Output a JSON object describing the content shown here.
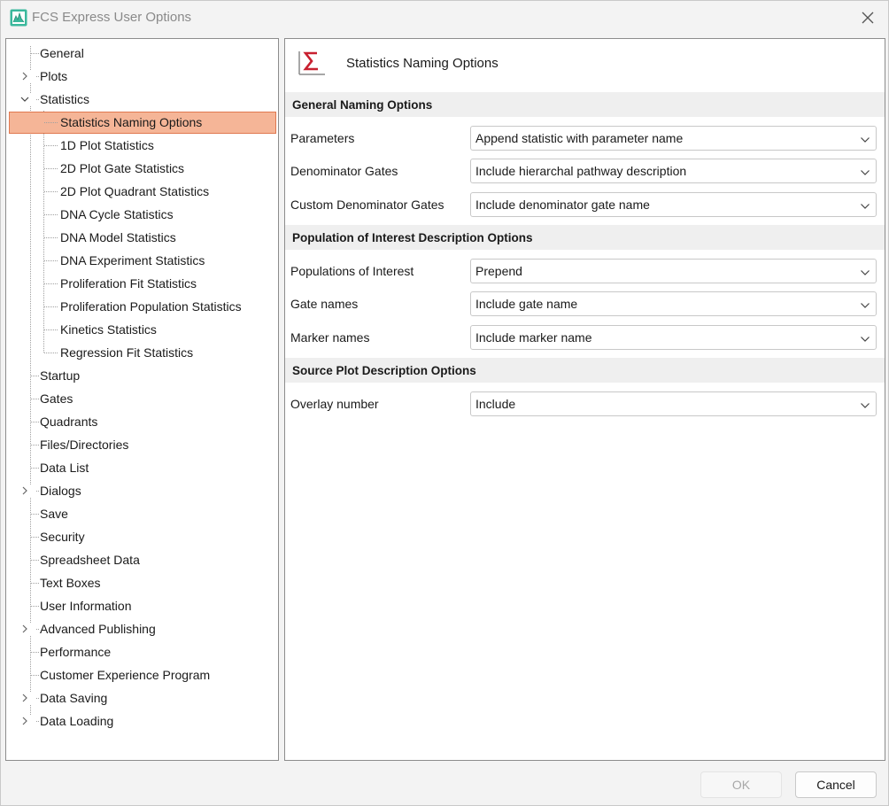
{
  "window": {
    "title": "FCS Express User Options"
  },
  "tree": {
    "items": [
      {
        "label": "General",
        "level": 0,
        "expandable": false
      },
      {
        "label": "Plots",
        "level": 0,
        "expandable": true,
        "expanded": false
      },
      {
        "label": "Statistics",
        "level": 0,
        "expandable": true,
        "expanded": true
      },
      {
        "label": "Statistics Naming Options",
        "level": 1,
        "selected": true
      },
      {
        "label": "1D Plot Statistics",
        "level": 1
      },
      {
        "label": "2D Plot Gate Statistics",
        "level": 1
      },
      {
        "label": "2D Plot Quadrant Statistics",
        "level": 1
      },
      {
        "label": "DNA Cycle Statistics",
        "level": 1
      },
      {
        "label": "DNA Model Statistics",
        "level": 1
      },
      {
        "label": "DNA Experiment Statistics",
        "level": 1
      },
      {
        "label": "Proliferation Fit Statistics",
        "level": 1
      },
      {
        "label": "Proliferation Population Statistics",
        "level": 1
      },
      {
        "label": "Kinetics Statistics",
        "level": 1
      },
      {
        "label": "Regression Fit Statistics",
        "level": 1
      },
      {
        "label": "Startup",
        "level": 0
      },
      {
        "label": "Gates",
        "level": 0
      },
      {
        "label": "Quadrants",
        "level": 0
      },
      {
        "label": "Files/Directories",
        "level": 0
      },
      {
        "label": "Data List",
        "level": 0
      },
      {
        "label": "Dialogs",
        "level": 0,
        "expandable": true,
        "expanded": false
      },
      {
        "label": "Save",
        "level": 0
      },
      {
        "label": "Security",
        "level": 0
      },
      {
        "label": "Spreadsheet Data",
        "level": 0
      },
      {
        "label": "Text Boxes",
        "level": 0
      },
      {
        "label": "User Information",
        "level": 0
      },
      {
        "label": "Advanced Publishing",
        "level": 0,
        "expandable": true,
        "expanded": false
      },
      {
        "label": "Performance",
        "level": 0
      },
      {
        "label": "Customer Experience Program",
        "level": 0
      },
      {
        "label": "Data Saving",
        "level": 0,
        "expandable": true,
        "expanded": false
      },
      {
        "label": "Data Loading",
        "level": 0,
        "expandable": true,
        "expanded": false
      }
    ]
  },
  "content": {
    "title": "Statistics Naming Options",
    "icon": "sigma-icon",
    "sections": [
      {
        "header": "General Naming Options",
        "options": [
          {
            "label": "Parameters",
            "value": "Append statistic with parameter name"
          },
          {
            "label": "Denominator Gates",
            "value": "Include hierarchal pathway description"
          },
          {
            "label": "Custom Denominator Gates",
            "value": "Include denominator gate name"
          }
        ]
      },
      {
        "header": "Population of Interest Description Options",
        "options": [
          {
            "label": "Populations of Interest",
            "value": "Prepend"
          },
          {
            "label": "Gate names",
            "value": "Include gate name"
          },
          {
            "label": "Marker names",
            "value": "Include marker name"
          }
        ]
      },
      {
        "header": "Source Plot Description Options",
        "options": [
          {
            "label": "Overlay number",
            "value": "Include"
          }
        ]
      }
    ]
  },
  "buttons": {
    "ok": "OK",
    "cancel": "Cancel",
    "ok_enabled": false
  },
  "colors": {
    "selection": "#f5b597",
    "selection_border": "#e07850",
    "sigma": "#c8202f",
    "app_icon": "#3bb89c"
  }
}
